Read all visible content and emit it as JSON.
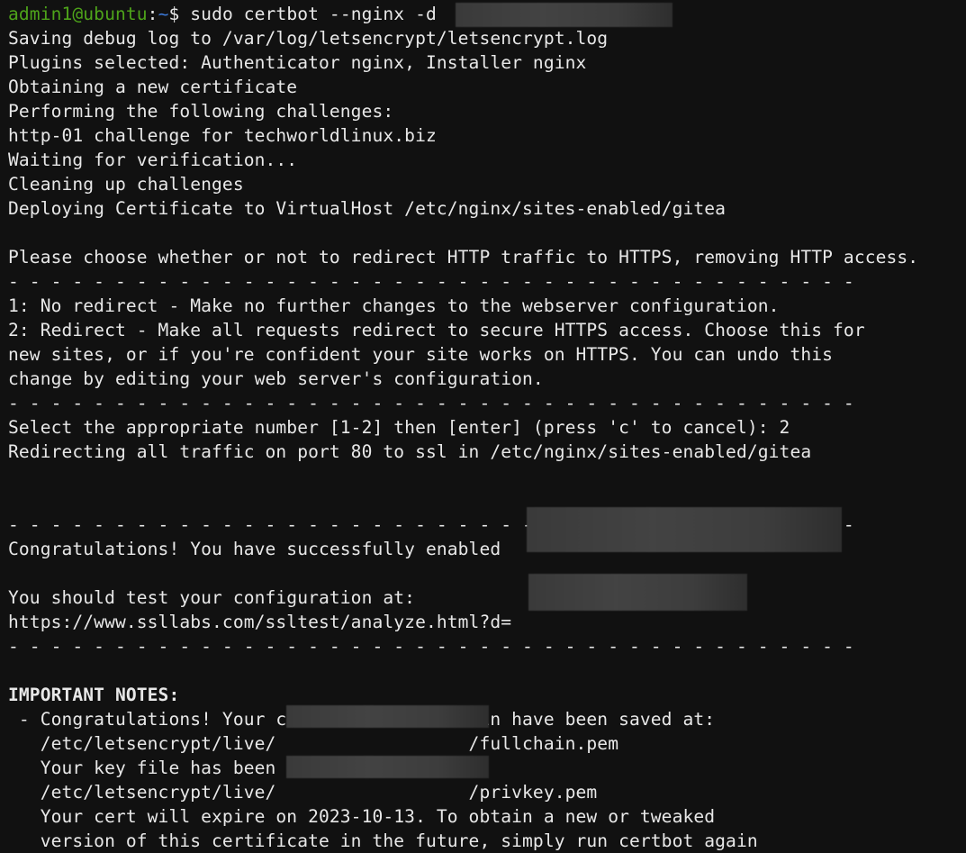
{
  "prompt": {
    "user_host": "admin1@ubuntu",
    "colon": ":",
    "path": "~",
    "symbol": "$",
    "command": " sudo certbot --nginx -d "
  },
  "lines": [
    "Saving debug log to /var/log/letsencrypt/letsencrypt.log",
    "Plugins selected: Authenticator nginx, Installer nginx",
    "Obtaining a new certificate",
    "Performing the following challenges:",
    "http-01 challenge for techworldlinux.biz",
    "Waiting for verification...",
    "Cleaning up challenges",
    "Deploying Certificate to VirtualHost /etc/nginx/sites-enabled/gitea",
    "",
    "Please choose whether or not to redirect HTTP traffic to HTTPS, removing HTTP access.",
    "- - - - - - - - - - - - - - - - - - - - - - - - - - - - - - - - - - - - - - - -",
    "1: No redirect - Make no further changes to the webserver configuration.",
    "2: Redirect - Make all requests redirect to secure HTTPS access. Choose this for",
    "new sites, or if you're confident your site works on HTTPS. You can undo this",
    "change by editing your web server's configuration.",
    "- - - - - - - - - - - - - - - - - - - - - - - - - - - - - - - - - - - - - - - -",
    "Select the appropriate number [1-2] then [enter] (press 'c' to cancel): 2",
    "Redirecting all traffic on port 80 to ssl in /etc/nginx/sites-enabled/gitea",
    "",
    "",
    "- - - - - - - - - - - - - - - - - - - - - - - - - - - - - - - - - - - - - - - -",
    "Congratulations! You have successfully enabled ",
    "",
    "You should test your configuration at:",
    "https://www.ssllabs.com/ssltest/analyze.html?d=",
    "- - - - - - - - - - - - - - - - - - - - - - - - - - - - - - - - - - - - - - - -",
    "",
    "IMPORTANT NOTES:",
    " - Congratulations! Your certificate and chain have been saved at:",
    "   /etc/letsencrypt/live/                  /fullchain.pem",
    "   Your key file has been saved at:",
    "   /etc/letsencrypt/live/                  /privkey.pem",
    "   Your cert will expire on 2023-10-13. To obtain a new or tweaked",
    "   version of this certificate in the future, simply run certbot again"
  ]
}
